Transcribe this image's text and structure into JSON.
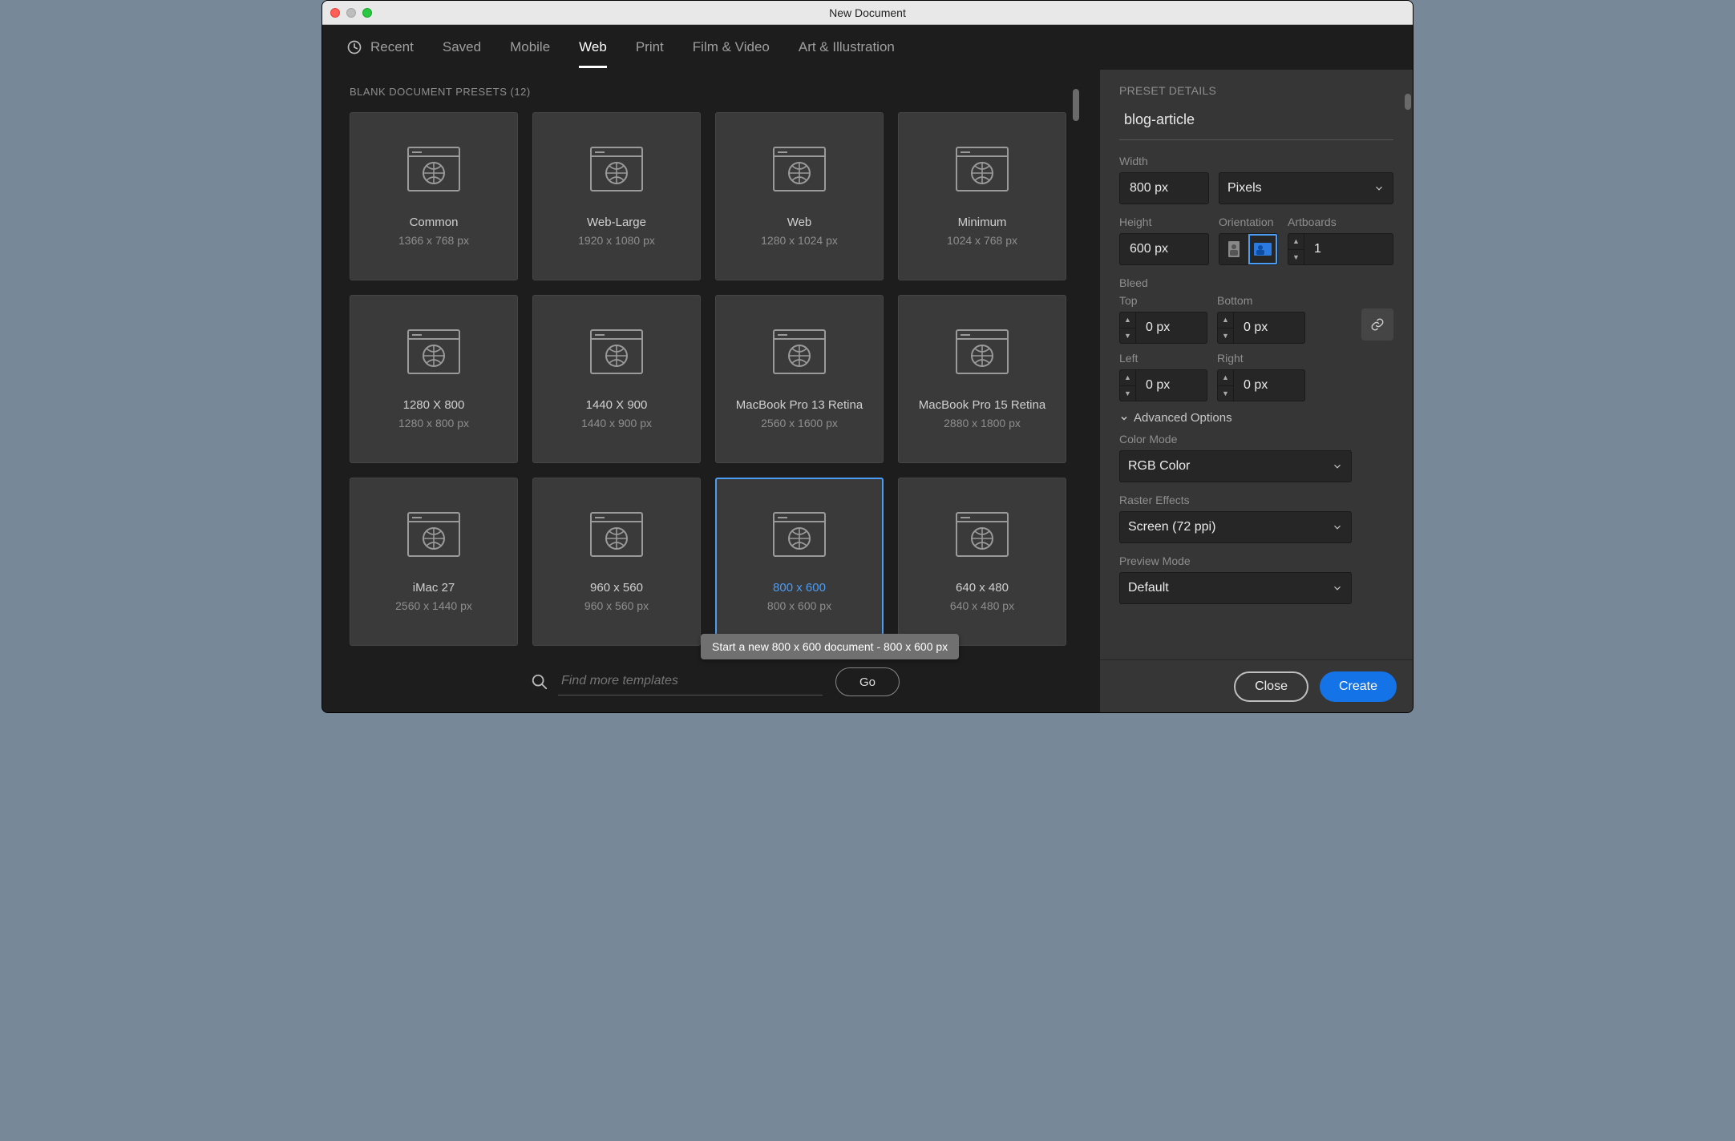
{
  "window": {
    "title": "New Document"
  },
  "tabs": {
    "recent": "Recent",
    "items": [
      "Saved",
      "Mobile",
      "Web",
      "Print",
      "Film & Video",
      "Art & Illustration"
    ],
    "active_index": 2
  },
  "presets": {
    "heading": "BLANK DOCUMENT PRESETS",
    "count_label": "(12)",
    "selected_index": 10,
    "cards": [
      {
        "name": "Common",
        "dims": "1366 x 768 px"
      },
      {
        "name": "Web-Large",
        "dims": "1920 x 1080 px"
      },
      {
        "name": "Web",
        "dims": "1280 x 1024 px"
      },
      {
        "name": "Minimum",
        "dims": "1024 x 768 px"
      },
      {
        "name": "1280 X 800",
        "dims": "1280 x 800 px"
      },
      {
        "name": "1440 X 900",
        "dims": "1440 x 900 px"
      },
      {
        "name": "MacBook Pro 13 Retina",
        "dims": "2560 x 1600 px"
      },
      {
        "name": "MacBook Pro 15 Retina",
        "dims": "2880 x 1800 px"
      },
      {
        "name": "iMac 27",
        "dims": "2560 x 1440 px"
      },
      {
        "name": "960 x 560",
        "dims": "960 x 560 px"
      },
      {
        "name": "800 x 600",
        "dims": "800 x 600 px"
      },
      {
        "name": "640 x 480",
        "dims": "640 x 480 px"
      }
    ]
  },
  "search": {
    "placeholder": "Find more templates",
    "go": "Go"
  },
  "tooltip": "Start a new 800 x 600 document - 800 x 600 px",
  "details": {
    "heading": "PRESET DETAILS",
    "name": "blog-article",
    "width_label": "Width",
    "width_value": "800 px",
    "units": "Pixels",
    "height_label": "Height",
    "height_value": "600 px",
    "orientation_label": "Orientation",
    "artboards_label": "Artboards",
    "artboards_value": "1",
    "bleed_label": "Bleed",
    "top_label": "Top",
    "top_value": "0 px",
    "bottom_label": "Bottom",
    "bottom_value": "0 px",
    "left_label": "Left",
    "left_value": "0 px",
    "right_label": "Right",
    "right_value": "0 px",
    "advanced_label": "Advanced Options",
    "color_mode_label": "Color Mode",
    "color_mode_value": "RGB Color",
    "raster_label": "Raster Effects",
    "raster_value": "Screen (72 ppi)",
    "preview_label": "Preview Mode",
    "preview_value": "Default"
  },
  "footer": {
    "close": "Close",
    "create": "Create"
  }
}
